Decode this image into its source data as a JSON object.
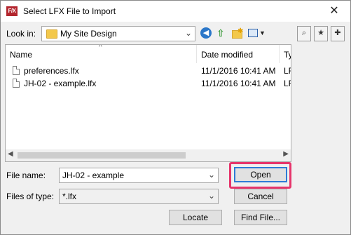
{
  "window": {
    "title": "Select LFX File to Import",
    "app_icon_text": "F/X",
    "close_glyph": "✕"
  },
  "toolbar": {
    "look_in_label": "Look in:",
    "look_in_value": "My Site Design"
  },
  "file_list": {
    "columns": [
      "Name",
      "Date modified",
      "Ty"
    ],
    "rows": [
      {
        "name": "preferences.lfx",
        "date": "11/1/2016 10:41 AM",
        "type": "LF"
      },
      {
        "name": "JH-02 - example.lfx",
        "date": "11/1/2016 10:41 AM",
        "type": "LF"
      }
    ]
  },
  "form": {
    "file_name_label": "File name:",
    "file_name_value": "JH-02 - example",
    "file_type_label": "Files of type:",
    "file_type_value": "*.lfx"
  },
  "buttons": {
    "open": "Open",
    "cancel": "Cancel",
    "locate": "Locate",
    "find_file": "Find File..."
  },
  "colors": {
    "highlight": "#e6356b",
    "default_button_border": "#2e7bd6"
  }
}
